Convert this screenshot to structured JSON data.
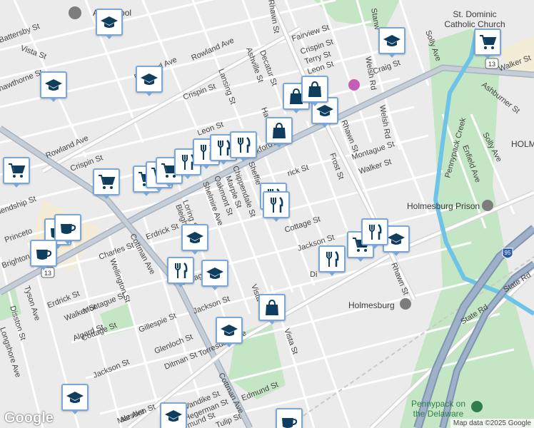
{
  "labels": {
    "achievement_school": "Ac         School",
    "st_dominic_1": "St. Dominic",
    "st_dominic_2": "Catholic Church",
    "holmesburg_prison": "Holmesburg Prison",
    "holmesburg": "Holmesburg",
    "pennypack_1": "Pennypack on",
    "pennypack_2": "the Delaware",
    "pennypack_creek": "Pennypack Creek",
    "holm": "HOLM",
    "rowland_ave_1": "Rowland Ave",
    "rowland_ave_2": "Rowland Ave",
    "rowland_ave_3": "Rowland Ave",
    "frankford_ave": "Frankford Ave",
    "cottman_ave_1": "Cottman Ave",
    "cottman_ave_2": "Cottman Ave",
    "torresdale_ave": "Torresdale Ave",
    "rhawn_st_1": "Rhawn St",
    "rhawn_st_2": "Rhawn St",
    "rhawn_st_3": "Rhawn St",
    "welsh_rd": "Welsh Rd",
    "welsh_rd_2": "Welsh Rd",
    "state_rd_1": "State Rd",
    "state_rd_2": "State Rd",
    "tyson_ave": "Tyson Ave",
    "disston_st": "Disston St",
    "longshore_ave": "Longshore Ave",
    "battersby_st": "Battersby St",
    "vista_st_1": "Vista St",
    "vista_st_2": "Vista St",
    "vista_st_3": "Vista St",
    "hawthorne_st": "hawthorne St",
    "lansing_st": "Lansing St",
    "ashville_st": "Ashville St",
    "decatur_st": "Decatur St",
    "fairview_st": "Fairview St",
    "crispin_st_1": "Crispin St",
    "crispin_st_2": "Crispin St",
    "crispin_st_3": "Crispin St",
    "terry_st": "Terry St",
    "leon_st_1": "Leon St",
    "leon_st_2": "Leon St",
    "craig_st": "Craig St",
    "solly_ave_1": "Solly Ave",
    "solly_ave_2": "Solly Ave",
    "walker_st_1": "Walker St",
    "walker_st_2": "Walker St",
    "walker_st_3": "Walker St",
    "ashburner_st": "Ashburner St",
    "montague_st_1": "Montague St",
    "montague_st_2": "Montague St",
    "enfield_ave": "Enfield Ave",
    "frost_st": "Frost St",
    "cottage_st_1": "Cottage St",
    "cottage_st_2": "Cottage St",
    "cottage_st_3": "Cottage St",
    "jackson_st_1": "Jackson St",
    "jackson_st_2": "Jackson St",
    "jackson_st_3": "Jackson St",
    "erdrick_st_1": "Erdrick St",
    "erdrick_st_2": "Erdrick St",
    "erdrick_st_3": "rick St",
    "loring_st": "Loring St",
    "bleigh": "Bleigh",
    "sheffield": "Sheffie",
    "shelmire_ave": "Shelmire Ave",
    "oakmont_st": "Oakmont St",
    "marple_st": "Marple St",
    "chippendale_st": "Chippendale St",
    "charles_st": "Charles St",
    "wellington_st": "Wellington St",
    "algard_st": "Algard St",
    "gillespie_st": "Gillespie St",
    "glenloch_st": "Glenloch St",
    "ditman_st_1": "Ditman St",
    "ditman_st_2": "Di",
    "marsden_st": "Marsden St",
    "vandike_st": "Vandike St",
    "hegerman_st": "Hegerman St",
    "tulip_st": "Tulip St",
    "edmund_st": "Edmund St",
    "brighton_st": "Brighton St",
    "princeton": "Princeto",
    "friendship_st": "iendship St",
    "harbison": "Ha",
    "ale_ave": "ale Ave",
    "mund_st": "mund St",
    "welsh_alt": "Stanw",
    "hwy_13": "13",
    "hwy_13b": "13",
    "hwy_95": "95"
  },
  "pins": [
    {
      "kind": "school",
      "icon": "graduation-cap-icon"
    },
    {
      "kind": "school",
      "icon": "graduation-cap-icon"
    },
    {
      "kind": "school",
      "icon": "graduation-cap-icon"
    },
    {
      "kind": "school",
      "icon": "graduation-cap-icon"
    },
    {
      "kind": "school",
      "icon": "graduation-cap-icon"
    },
    {
      "kind": "school",
      "icon": "graduation-cap-icon"
    },
    {
      "kind": "school",
      "icon": "graduation-cap-icon"
    },
    {
      "kind": "school",
      "icon": "graduation-cap-icon"
    },
    {
      "kind": "school",
      "icon": "graduation-cap-icon"
    },
    {
      "kind": "school",
      "icon": "graduation-cap-icon"
    },
    {
      "kind": "school",
      "icon": "graduation-cap-icon"
    },
    {
      "kind": "grocery",
      "icon": "shopping-cart-icon"
    },
    {
      "kind": "grocery",
      "icon": "shopping-cart-icon"
    },
    {
      "kind": "grocery",
      "icon": "shopping-cart-icon"
    },
    {
      "kind": "grocery",
      "icon": "shopping-cart-icon"
    },
    {
      "kind": "grocery",
      "icon": "shopping-cart-icon"
    },
    {
      "kind": "grocery",
      "icon": "shopping-cart-icon"
    },
    {
      "kind": "grocery",
      "icon": "shopping-cart-icon"
    },
    {
      "kind": "restaurant",
      "icon": "fork-knife-icon"
    },
    {
      "kind": "restaurant",
      "icon": "fork-knife-icon"
    },
    {
      "kind": "restaurant",
      "icon": "fork-knife-icon"
    },
    {
      "kind": "restaurant",
      "icon": "fork-knife-icon"
    },
    {
      "kind": "restaurant",
      "icon": "fork-knife-icon"
    },
    {
      "kind": "restaurant",
      "icon": "fork-knife-icon"
    },
    {
      "kind": "restaurant",
      "icon": "fork-knife-icon"
    },
    {
      "kind": "restaurant",
      "icon": "fork-knife-icon"
    },
    {
      "kind": "restaurant",
      "icon": "fork-knife-icon"
    },
    {
      "kind": "shopping",
      "icon": "shopping-bag-icon"
    },
    {
      "kind": "shopping",
      "icon": "shopping-bag-icon"
    },
    {
      "kind": "shopping",
      "icon": "shopping-bag-icon"
    },
    {
      "kind": "shopping",
      "icon": "shopping-bag-icon"
    },
    {
      "kind": "cafe",
      "icon": "coffee-cup-icon"
    },
    {
      "kind": "cafe",
      "icon": "coffee-cup-icon"
    },
    {
      "kind": "cafe",
      "icon": "coffee-cup-icon"
    },
    {
      "kind": "cafe",
      "icon": "coffee-cup-icon"
    }
  ],
  "logo": "Google",
  "attribution": "Map data ©2025 Google",
  "colors": {
    "background": "#ebebeb",
    "road": "#ffffff",
    "arterial": "#dadada",
    "highway": "#8da1bd",
    "water": "#6ec3e6",
    "park": "#c5e6c4",
    "pin_border": "#7aa7d6",
    "pin_icon": "#0e3d5e"
  }
}
